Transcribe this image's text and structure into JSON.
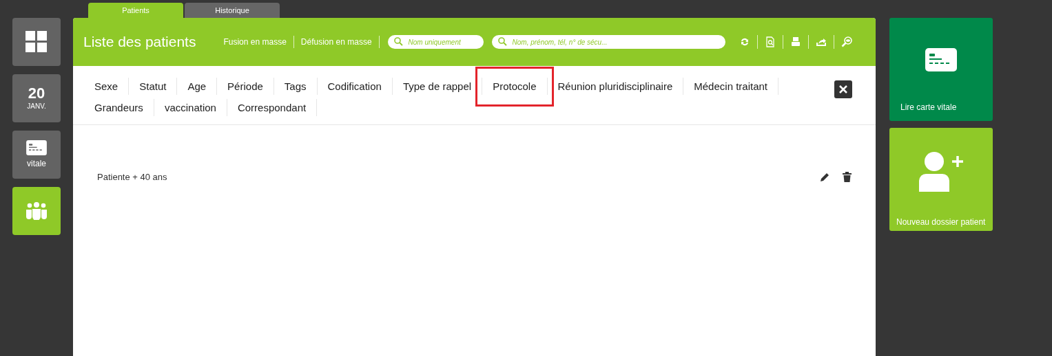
{
  "tabs": [
    {
      "label": "Patients",
      "selected": true
    },
    {
      "label": "Historique",
      "selected": false
    }
  ],
  "left_nav": [
    {
      "kind": "dashboard",
      "selected": false
    },
    {
      "kind": "date",
      "day": "20",
      "month": "JANV.",
      "selected": false
    },
    {
      "kind": "card",
      "label": "vitale",
      "selected": false
    },
    {
      "kind": "patients",
      "selected": true
    }
  ],
  "header": {
    "title": "Liste des patients",
    "actions": [
      "Fusion en masse",
      "Défusion en masse"
    ],
    "search_name": {
      "placeholder": "Nom uniquement"
    },
    "search_all": {
      "placeholder": "Nom, prénom, tél, n° de sécu..."
    },
    "tools": [
      {
        "kind": "refresh"
      },
      {
        "kind": "document-search"
      },
      {
        "kind": "print"
      },
      {
        "kind": "share"
      },
      {
        "kind": "preview"
      }
    ]
  },
  "filters": [
    {
      "label": "Sexe",
      "highlighted": false
    },
    {
      "label": "Statut",
      "highlighted": false
    },
    {
      "label": "Age",
      "highlighted": false
    },
    {
      "label": "Période",
      "highlighted": false
    },
    {
      "label": "Tags",
      "highlighted": false
    },
    {
      "label": "Codification",
      "highlighted": false
    },
    {
      "label": "Type de rappel",
      "highlighted": false
    },
    {
      "label": "Protocole",
      "highlighted": true
    },
    {
      "label": "Réunion pluridisciplinaire",
      "highlighted": false
    },
    {
      "label": "Médecin traitant",
      "highlighted": false
    },
    {
      "label": "Grandeurs",
      "highlighted": false
    },
    {
      "label": "vaccination",
      "highlighted": false
    },
    {
      "label": "Correspondant",
      "highlighted": false
    }
  ],
  "saved_filters": [
    {
      "label": "Patiente + 40 ans"
    }
  ],
  "right_tiles": [
    {
      "kind": "card",
      "label": "Lire carte vitale"
    },
    {
      "kind": "new-patient",
      "label": "Nouveau dossier patient"
    }
  ]
}
